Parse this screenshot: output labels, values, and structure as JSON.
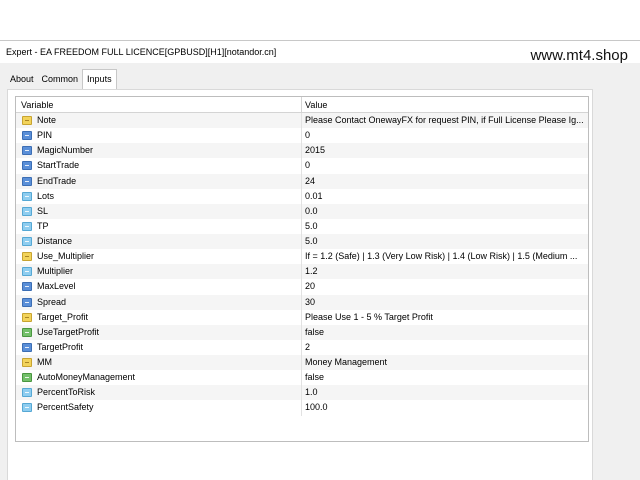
{
  "window": {
    "title": "Expert - EA FREEDOM FULL LICENCE[GPBUSD][H1][notandor.cn]"
  },
  "watermark": "www.mt4.shop",
  "tabs": [
    {
      "label": "About",
      "active": false
    },
    {
      "label": "Common",
      "active": false
    },
    {
      "label": "Inputs",
      "active": true
    }
  ],
  "table": {
    "columns": [
      "Variable",
      "Value"
    ],
    "rows": [
      {
        "variable": "Note",
        "value": "Please Contact OnewayFX for request PIN, if Full License Please Ig...",
        "icon": "string-icon"
      },
      {
        "variable": "PIN",
        "value": "0",
        "icon": "integer-icon"
      },
      {
        "variable": "MagicNumber",
        "value": "2015",
        "icon": "integer-icon"
      },
      {
        "variable": "StartTrade",
        "value": "0",
        "icon": "integer-icon"
      },
      {
        "variable": "EndTrade",
        "value": "24",
        "icon": "integer-icon"
      },
      {
        "variable": "Lots",
        "value": "0.01",
        "icon": "double-icon"
      },
      {
        "variable": "SL",
        "value": "0.0",
        "icon": "double-icon"
      },
      {
        "variable": "TP",
        "value": "5.0",
        "icon": "double-icon"
      },
      {
        "variable": "Distance",
        "value": "5.0",
        "icon": "double-icon"
      },
      {
        "variable": "Use_Multiplier",
        "value": "If = 1.2 (Safe) | 1.3 (Very Low Risk) | 1.4 (Low Risk) | 1.5 (Medium ...",
        "icon": "string-icon"
      },
      {
        "variable": "Multiplier",
        "value": "1.2",
        "icon": "double-icon"
      },
      {
        "variable": "MaxLevel",
        "value": "20",
        "icon": "integer-icon"
      },
      {
        "variable": "Spread",
        "value": "30",
        "icon": "integer-icon"
      },
      {
        "variable": "Target_Profit",
        "value": "Please Use 1 - 5 % Target Profit",
        "icon": "string-icon"
      },
      {
        "variable": "UseTargetProfit",
        "value": "false",
        "icon": "boolean-icon"
      },
      {
        "variable": "TargetProfit",
        "value": "2",
        "icon": "integer-icon"
      },
      {
        "variable": "MM",
        "value": "Money Management",
        "icon": "string-icon"
      },
      {
        "variable": "AutoMoneyManagement",
        "value": "false",
        "icon": "boolean-icon"
      },
      {
        "variable": "PercentToRisk",
        "value": "1.0",
        "icon": "double-icon"
      },
      {
        "variable": "PercentSafety",
        "value": "100.0",
        "icon": "double-icon"
      }
    ]
  }
}
